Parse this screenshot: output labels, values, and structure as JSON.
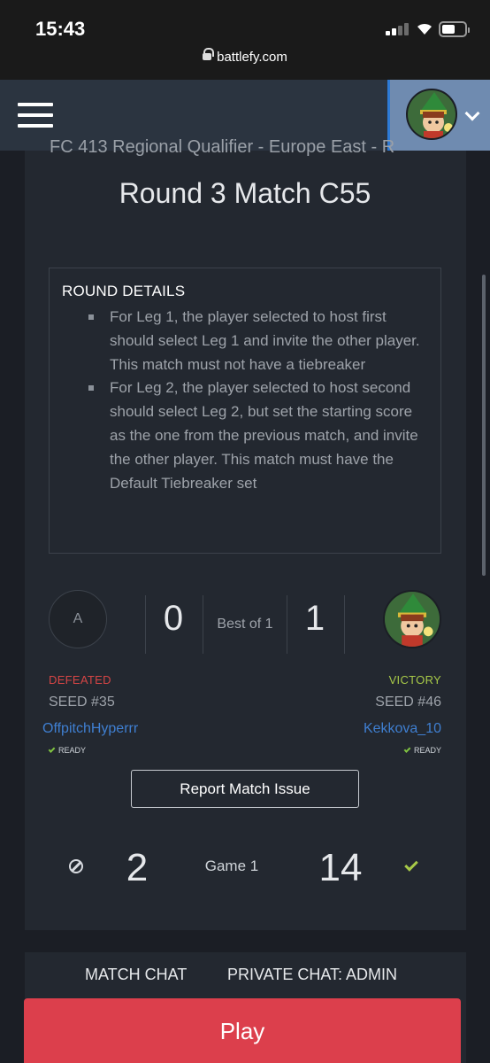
{
  "status_bar": {
    "time": "15:43"
  },
  "browser": {
    "url": "battlefy.com"
  },
  "match": {
    "cut_title": "FC 413 Regional Qualifier - Europe East - R",
    "title": "Round 3 Match C55",
    "round_details": {
      "heading": "ROUND DETAILS",
      "items": [
        "For Leg 1, the player selected to host first should select Leg 1 and invite the other player. This match must not have a tiebreaker",
        "For Leg 2, the player selected to host second should select Leg 2, but set the starting score as the one from the previous match, and invite the other player. This match must have the Default Tiebreaker set"
      ]
    },
    "scoreboard": {
      "left_avatar_letter": "A",
      "left_score": "0",
      "best_of": "Best of 1",
      "right_score": "1"
    },
    "team_left": {
      "result": "DEFEATED",
      "seed": "SEED #35",
      "name": "OffpitchHyperrr",
      "ready": "READY"
    },
    "team_right": {
      "result": "VICTORY",
      "seed": "SEED #46",
      "name": "Kekkova_10",
      "ready": "READY"
    },
    "report_button": "Report Match Issue",
    "game": {
      "left_score": "2",
      "label": "Game 1",
      "right_score": "14"
    }
  },
  "chat": {
    "tabs": [
      "MATCH CHAT",
      "PRIVATE CHAT: ADMIN"
    ]
  },
  "play_button": "Play",
  "colors": {
    "defeated": "#d64545",
    "victory": "#a7c948",
    "link": "#3f7fd1",
    "play": "#dc3f4c"
  }
}
